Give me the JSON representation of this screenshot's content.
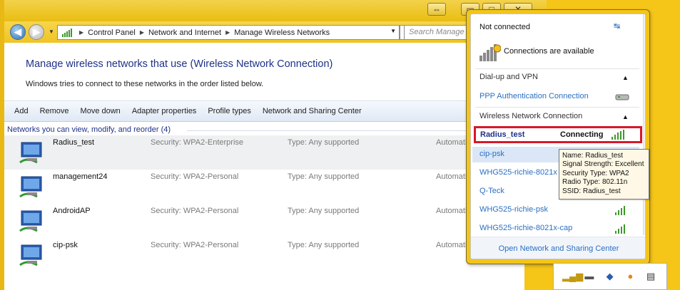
{
  "window": {
    "caption_buttons": [
      "⇔",
      "▭",
      "□",
      "✕"
    ],
    "nav": {
      "back_icon": "arrow-left-icon",
      "forward_icon": "arrow-right-icon"
    },
    "address": {
      "segments": [
        "Control Panel",
        "Network and Internet",
        "Manage Wireless Networks"
      ],
      "refresh_glyph": "↻"
    },
    "search": {
      "placeholder": "Search Manage Wir"
    },
    "heading": "Manage wireless networks that use (Wireless Network Connection)",
    "subtext": "Windows tries to connect to these networks in the order listed below.",
    "toolbar": [
      "Add",
      "Remove",
      "Move down",
      "Adapter properties",
      "Profile types",
      "Network and Sharing Center"
    ],
    "group_title": "Networks you can view, modify, and reorder (4)",
    "networks": [
      {
        "name": "Radius_test",
        "security": "Security: WPA2-Enterprise",
        "type": "Type: Any supported",
        "mode": "Automatic"
      },
      {
        "name": "management24",
        "security": "Security: WPA2-Personal",
        "type": "Type: Any supported",
        "mode": "Automatic"
      },
      {
        "name": "AndroidAP",
        "security": "Security: WPA2-Personal",
        "type": "Type: Any supported",
        "mode": "Automatic"
      },
      {
        "name": "cip-psk",
        "security": "Security: WPA2-Personal",
        "type": "Type: Any supported",
        "mode": "Automatic"
      }
    ]
  },
  "flyout": {
    "status": "Not connected",
    "available": "Connections are available",
    "dialup_header": "Dial-up and VPN",
    "ppp_link": "PPP Authentication Connection",
    "wireless_header": "Wireless Network Connection",
    "active": {
      "name": "Radius_test",
      "state": "Connecting"
    },
    "items": [
      "cip-psk",
      "WHG525-richie-8021x",
      "Q-Teck",
      "WHG525-richie-psk",
      "WHG525-richie-8021x-cap"
    ],
    "footer": "Open Network and Sharing Center"
  },
  "tooltip": {
    "lines": [
      "Name: Radius_test",
      "Signal Strength: Excellent",
      "Security Type: WPA2",
      "Radio Type: 802.11n",
      "SSID: Radius_test"
    ]
  },
  "colors": {
    "accent": "#2b6fc2",
    "heading": "#1e3287",
    "highlight_border": "#d7182a",
    "signal": "#3c9a2a",
    "window_frame": "#f5c518"
  }
}
